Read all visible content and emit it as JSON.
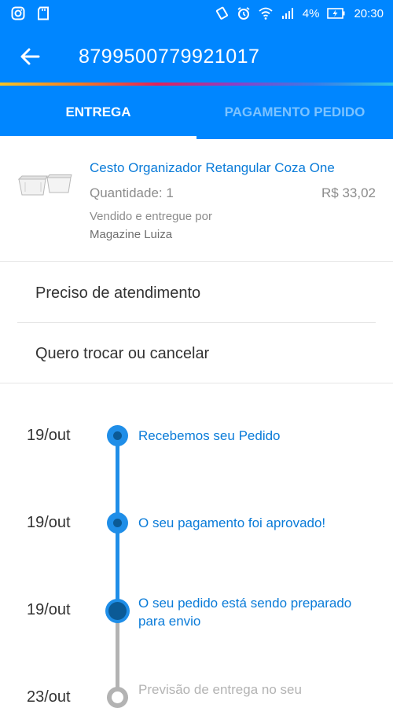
{
  "status_bar": {
    "battery": "4%",
    "time": "20:30",
    "icons": [
      "instagram-icon",
      "sd-card-icon",
      "vibrate-icon",
      "alarm-icon",
      "wifi-icon",
      "signal-icon",
      "battery-charging-icon"
    ]
  },
  "app_bar": {
    "order_number": "8799500779921017"
  },
  "tabs": [
    {
      "label": "ENTREGA",
      "active": true
    },
    {
      "label": "PAGAMENTO PEDIDO",
      "active": false
    }
  ],
  "product": {
    "name": "Cesto Organizador Retangular Coza One",
    "quantity": "Quantidade: 1",
    "price": "R$ 33,02",
    "seller_label": "Vendido e entregue por",
    "seller": "Magazine Luiza"
  },
  "menu": [
    {
      "label": "Preciso de atendimento"
    },
    {
      "label": "Quero trocar ou cancelar"
    }
  ],
  "timeline": [
    {
      "date": "19/out",
      "text": "Recebemos seu Pedido",
      "status": "done"
    },
    {
      "date": "19/out",
      "text": "O seu pagamento foi aprovado!",
      "status": "done"
    },
    {
      "date": "19/out",
      "text": "O seu pedido está sendo preparado para envio",
      "status": "current"
    },
    {
      "date": "23/out",
      "text": "Previsão de entrega no seu",
      "status": "pending"
    }
  ],
  "colors": {
    "primary": "#0086ff",
    "link": "#0a7bd8",
    "timeline_done": "#1f8ee8",
    "timeline_current": "#0b5a96",
    "timeline_pending": "#b3b3b3"
  }
}
